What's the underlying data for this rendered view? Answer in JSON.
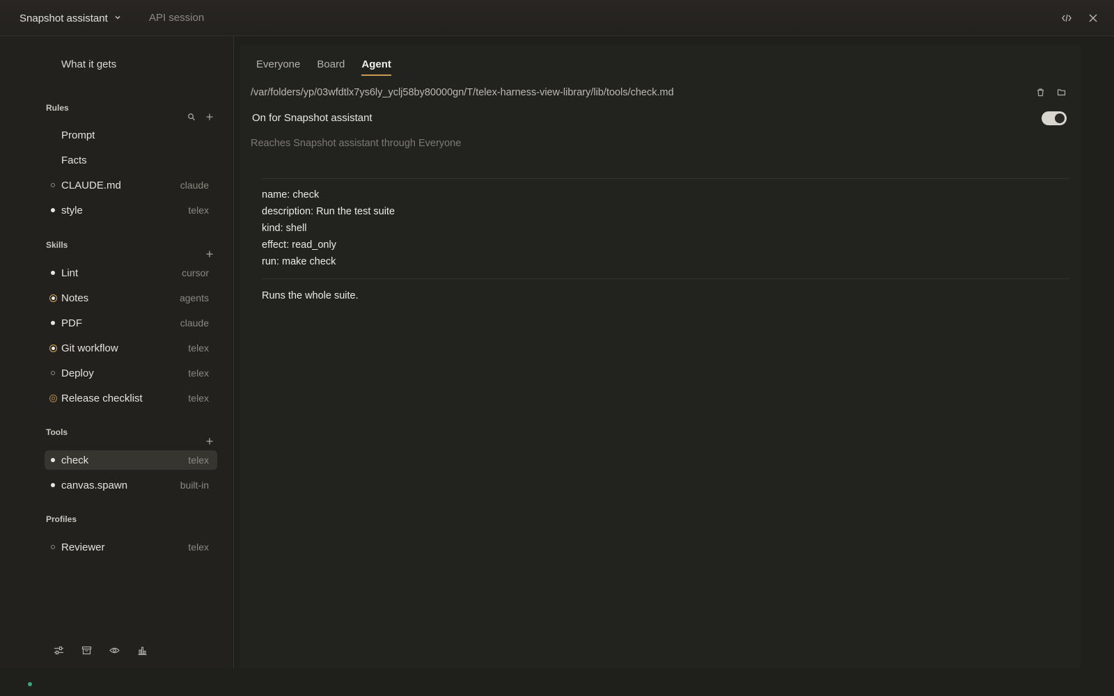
{
  "topbar": {
    "app_name": "Snapshot assistant",
    "session": "API session",
    "icons": [
      "code-toggle-icon",
      "close-icon"
    ]
  },
  "sidebar": {
    "what_it_gets": "What it gets",
    "rules": {
      "title": "Rules",
      "items": [
        {
          "label": "Prompt",
          "source": "",
          "marker": "none"
        },
        {
          "label": "Facts",
          "source": "",
          "marker": "none"
        },
        {
          "label": "CLAUDE.md",
          "source": "claude",
          "marker": "ring"
        },
        {
          "label": "style",
          "source": "telex",
          "marker": "filled"
        }
      ]
    },
    "skills": {
      "title": "Skills",
      "items": [
        {
          "label": "Lint",
          "source": "cursor",
          "marker": "filled"
        },
        {
          "label": "Notes",
          "source": "agents",
          "marker": "amber"
        },
        {
          "label": "PDF",
          "source": "claude",
          "marker": "filled"
        },
        {
          "label": "Git workflow",
          "source": "telex",
          "marker": "amber"
        },
        {
          "label": "Deploy",
          "source": "telex",
          "marker": "ring"
        },
        {
          "label": "Release checklist",
          "source": "telex",
          "marker": "amber-ring"
        }
      ]
    },
    "tools": {
      "title": "Tools",
      "items": [
        {
          "label": "check",
          "source": "telex",
          "marker": "filled",
          "selected": true
        },
        {
          "label": "canvas.spawn",
          "source": "built-in",
          "marker": "filled"
        }
      ]
    },
    "profiles": {
      "title": "Profiles",
      "items": [
        {
          "label": "Reviewer",
          "source": "telex",
          "marker": "ring"
        }
      ]
    },
    "bottom_icons": [
      "sliders-icon",
      "archive-icon",
      "eye-icon",
      "chart-icon"
    ]
  },
  "main": {
    "tabs": [
      "Everyone",
      "Board",
      "Agent"
    ],
    "active_tab": "Agent",
    "path": "/var/folders/yp/03wfdtlx7ys6ly_yclj58by80000gn/T/telex-harness-view-library/lib/tools/check.md",
    "on_for": "On for Snapshot assistant",
    "toggle_on": true,
    "reaches": "Reaches Snapshot assistant through Everyone",
    "frontmatter": [
      "name: check",
      "description: Run the test suite",
      "kind: shell",
      "effect: read_only",
      "run: make check"
    ],
    "body": "Runs the whole suite."
  },
  "colors": {
    "accent": "#c89c56",
    "status_online": "#3fa37a"
  }
}
